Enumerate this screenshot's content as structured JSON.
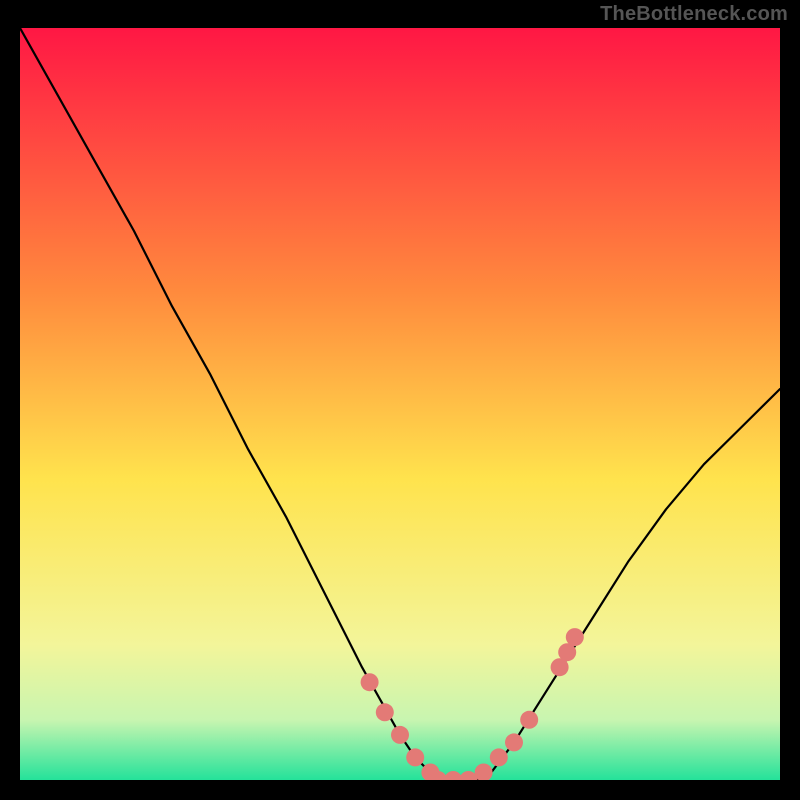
{
  "watermark": "TheBottleneck.com",
  "colors": {
    "bg": "#000000",
    "curve_stroke": "#000000",
    "marker_fill": "#e37a76",
    "gradient_top": "#ff1744",
    "gradient_mid_upper": "#ff8a3d",
    "gradient_mid": "#ffe34d",
    "gradient_lower1": "#f3f59a",
    "gradient_lower2": "#c8f5b0",
    "gradient_bottom": "#24e29a"
  },
  "chart_data": {
    "type": "line",
    "title": "",
    "xlabel": "",
    "ylabel": "",
    "xlim": [
      0,
      100
    ],
    "ylim": [
      0,
      100
    ],
    "series": [
      {
        "name": "bottleneck-curve",
        "x": [
          0,
          5,
          10,
          15,
          20,
          25,
          30,
          35,
          40,
          45,
          50,
          52,
          54,
          56,
          58,
          60,
          62,
          65,
          70,
          75,
          80,
          85,
          90,
          95,
          100
        ],
        "y": [
          100,
          91,
          82,
          73,
          63,
          54,
          44,
          35,
          25,
          15,
          6,
          3,
          1,
          0,
          0,
          0,
          1,
          5,
          13,
          21,
          29,
          36,
          42,
          47,
          52
        ]
      }
    ],
    "markers": {
      "name": "highlighted-points",
      "x": [
        46,
        48,
        50,
        52,
        54,
        55,
        57,
        59,
        61,
        63,
        65,
        67,
        71,
        72,
        73
      ],
      "y": [
        13,
        9,
        6,
        3,
        1,
        0,
        0,
        0,
        1,
        3,
        5,
        8,
        15,
        17,
        19
      ]
    }
  }
}
